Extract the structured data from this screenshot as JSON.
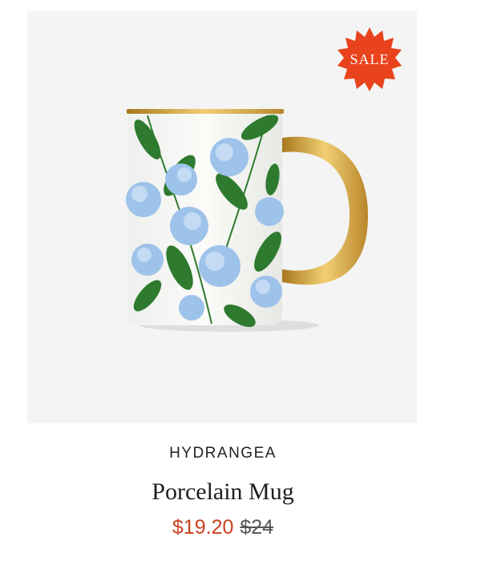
{
  "product": {
    "badge": "SALE",
    "collection": "HYDRANGEA",
    "name": "Porcelain Mug",
    "sale_price": "$19.20",
    "original_price": "$24",
    "image_alt": "Hydrangea porcelain mug with gold handle"
  },
  "colors": {
    "badge": "#e8431c",
    "sale_price": "#c8401f",
    "image_background": "#f4f4f4"
  }
}
